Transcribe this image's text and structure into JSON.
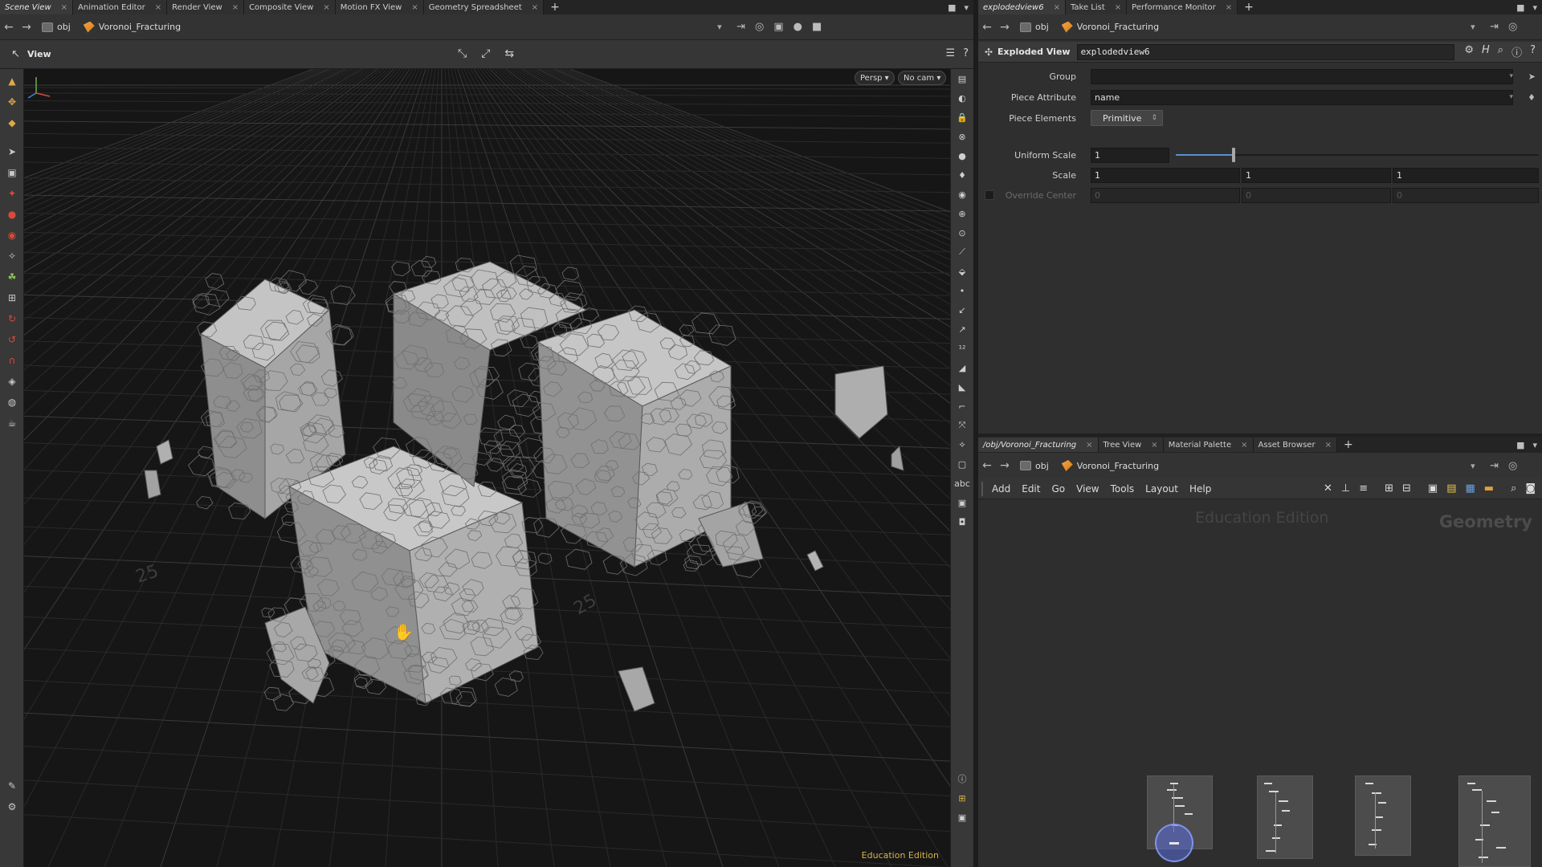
{
  "left": {
    "tabs": [
      {
        "label": "Scene View",
        "active": true
      },
      {
        "label": "Animation Editor",
        "active": false
      },
      {
        "label": "Render View",
        "active": false
      },
      {
        "label": "Composite View",
        "active": false
      },
      {
        "label": "Motion FX View",
        "active": false
      },
      {
        "label": "Geometry Spreadsheet",
        "active": false
      }
    ],
    "tab_close": "×",
    "tab_add": "+",
    "path": {
      "obj": "obj",
      "node": "Voronoi_Fracturing"
    },
    "view_label": "View",
    "persp_label": "Persp ▾",
    "cam_label": "No cam ▾",
    "edu_label": "Education Edition",
    "grid_labels": [
      "25",
      "25"
    ]
  },
  "right": {
    "tabs": [
      {
        "label": "explodedview6",
        "active": true
      },
      {
        "label": "Take List",
        "active": false
      },
      {
        "label": "Performance Monitor",
        "active": false
      }
    ],
    "tab_close": "×",
    "tab_add": "+",
    "path": {
      "obj": "obj",
      "node": "Voronoi_Fracturing"
    },
    "node_type": "Exploded View",
    "node_name": "explodedview6",
    "params": {
      "group_label": "Group",
      "group_value": "",
      "piece_attr_label": "Piece Attribute",
      "piece_attr_value": "name",
      "piece_elem_label": "Piece Elements",
      "piece_elem_value": "Primitive",
      "uniform_scale_label": "Uniform Scale",
      "uniform_scale_value": "1",
      "uniform_scale_slider_fraction": 0.16,
      "scale_label": "Scale",
      "scale_x": "1",
      "scale_y": "1",
      "scale_z": "1",
      "override_center_label": "Override Center",
      "override_x": "0",
      "override_y": "0",
      "override_z": "0"
    },
    "net_tabs": [
      {
        "label": "/obj/Voronoi_Fracturing",
        "active": true
      },
      {
        "label": "Tree View",
        "active": false
      },
      {
        "label": "Material Palette",
        "active": false
      },
      {
        "label": "Asset Browser",
        "active": false
      }
    ],
    "net_path": {
      "obj": "obj",
      "node": "Voronoi_Fracturing"
    },
    "menu": [
      "Add",
      "Edit",
      "Go",
      "View",
      "Tools",
      "Layout",
      "Help"
    ],
    "net_edu": "Education Edition",
    "net_context": "Geometry"
  },
  "colors": {
    "accent": "#5a8fd1",
    "edu_yellow": "#d8b24a",
    "viewport_bg": "#161616"
  }
}
